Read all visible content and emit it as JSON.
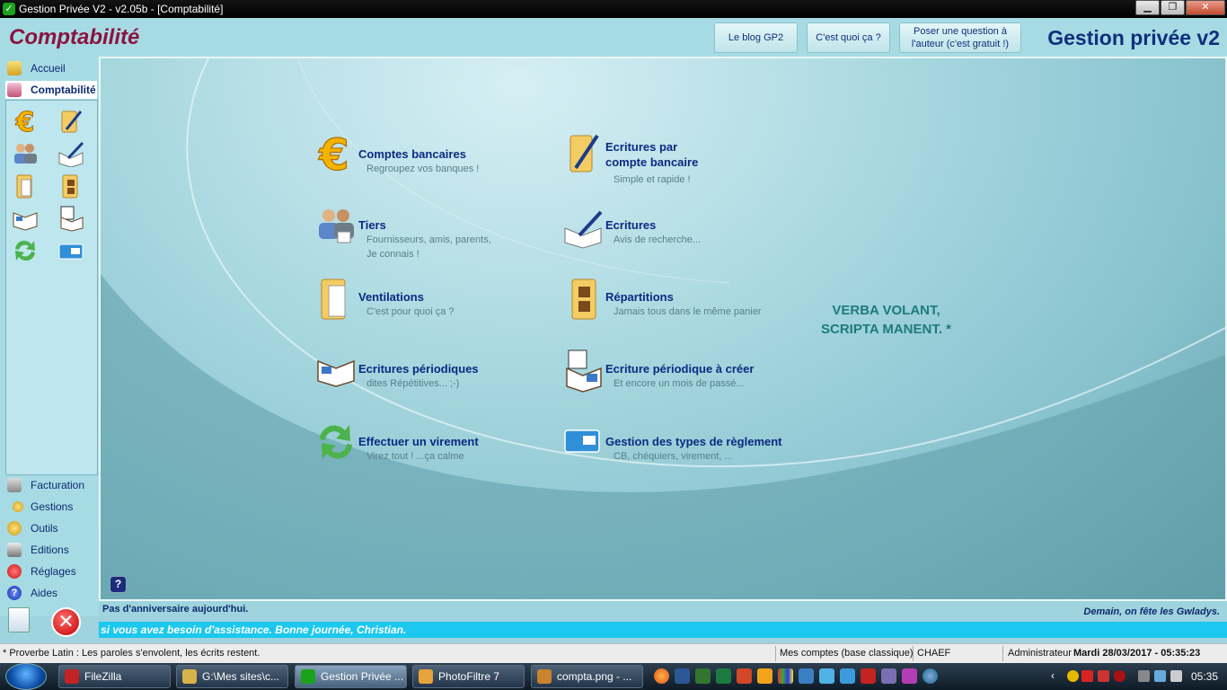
{
  "window": {
    "title": "Gestion Privée V2 - v2.05b - [Comptabilité]",
    "buttons": {
      "minimize": "▁",
      "maximize": "❐",
      "close": "✕"
    }
  },
  "header": {
    "section_title": "Comptabilité",
    "brand": "Gestion privée v2",
    "blog_button": "Le blog GP2",
    "whatis_button": "C'est quoi ça ?",
    "question_button": "Poser une question à l'auteur (c'est gratuit !)"
  },
  "sidebar": {
    "top_items": [
      {
        "label": "Accueil",
        "icon": "home-icon"
      },
      {
        "label": "Comptabilité",
        "icon": "ledger-icon"
      }
    ],
    "bottom_items": [
      {
        "label": "Facturation",
        "icon": "invoice-icon"
      },
      {
        "label": "Gestions",
        "icon": "key-icon"
      },
      {
        "label": "Outils",
        "icon": "tools-icon"
      },
      {
        "label": "Editions",
        "icon": "printer-icon"
      },
      {
        "label": "Réglages",
        "icon": "settings-icon"
      },
      {
        "label": "Aides",
        "icon": "help-icon"
      }
    ]
  },
  "menu": [
    {
      "title": "Comptes bancaires",
      "sub": "Regroupez vos banques !",
      "icon": "euro-icon"
    },
    {
      "title": "Ecritures par compte bancaire",
      "sub": "Simple et rapide !",
      "icon": "folder-pen-icon"
    },
    {
      "title": "Tiers",
      "sub": "Fournisseurs, amis, parents, Je connais !",
      "icon": "people-icon"
    },
    {
      "title": "Ecritures",
      "sub": "Avis de recherche...",
      "icon": "book-pen-icon"
    },
    {
      "title": "Ventilations",
      "sub": "C'est pour quoi ça ?",
      "icon": "folder-docs-icon"
    },
    {
      "title": "Répartitions",
      "sub": "Jamais tous dans le même panier",
      "icon": "folder-split-icon"
    },
    {
      "title": "Ecritures périodiques",
      "sub": "dites Répétitives...   ;-)",
      "icon": "open-book-icon"
    },
    {
      "title": "Ecriture périodique à créer",
      "sub": "Et encore un mois de passé...",
      "icon": "book-calendar-icon"
    },
    {
      "title": "Effectuer un virement",
      "sub": "Virez tout ! ...ça calme",
      "icon": "transfer-arrows-icon"
    },
    {
      "title": "Gestion des types de règlement",
      "sub": "CB, chéquiers, virement, ...",
      "icon": "card-icon"
    }
  ],
  "motto": {
    "line1": "VERBA VOLANT,",
    "line2": "SCRIPTA MANENT. *"
  },
  "help_glyph": "?",
  "info": {
    "birthday": "Pas d'anniversaire aujourd'hui.",
    "feast": "Demain, on fête les Gwladys.",
    "assistance": "si vous avez besoin d'assistance. Bonne journée, Christian."
  },
  "statusbar": {
    "proverb": "* Proverbe Latin : Les paroles s'envolent, les écrits restent.",
    "database": "Mes comptes (base classique)",
    "user_code": "CHAEF",
    "role": "Administrateur",
    "datetime": "Mardi 28/03/2017 - 05:35:23"
  },
  "taskbar": {
    "items": [
      {
        "label": "FileZilla",
        "color": "#c32323"
      },
      {
        "label": "G:\\Mes sites\\c...",
        "color": "#d8b24a"
      },
      {
        "label": "Gestion Privée ...",
        "color": "#1aa31a"
      },
      {
        "label": "PhotoFiltre 7",
        "color": "#e5a33a"
      },
      {
        "label": "compta.png - ...",
        "color": "#c9842f"
      }
    ],
    "time": "05:35"
  },
  "colors": {
    "accent": "#8b1340",
    "brand": "#102f7c",
    "helpline": "#1cc8ee"
  }
}
